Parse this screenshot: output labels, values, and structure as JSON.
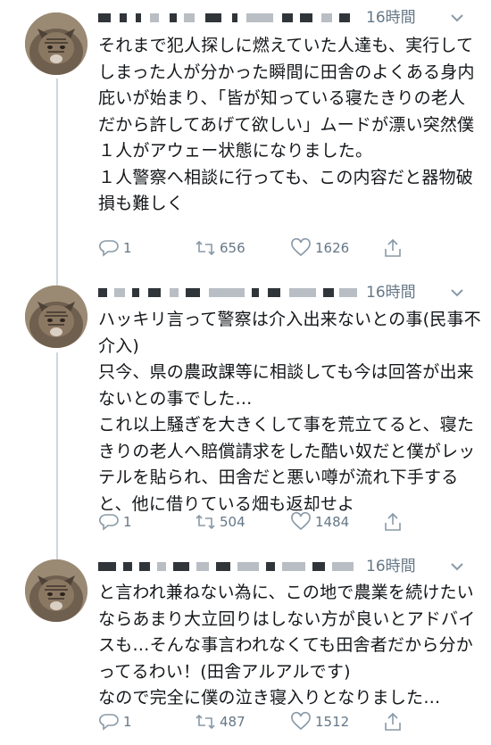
{
  "tweets": [
    {
      "time": "16時間",
      "text": "それまで犯人探しに燃えていた人達も、実行してしまった人が分かった瞬間に田舎のよくある身内庇いが始まり、「皆が知っている寝たきりの老人だから許してあげて欲しい」ムードが漂い突然僕１人がアウェー状態になりました。\n１人警察へ相談に行っても、この内容だと器物破損も難しく",
      "replies": "1",
      "retweets": "656",
      "likes": "1626"
    },
    {
      "time": "16時間",
      "text": "ハッキリ言って警察は介入出来ないとの事(民事不介入)\n只今、県の農政課等に相談しても今は回答が出来ないとの事でした…\nこれ以上騒ぎを大きくして事を荒立てると、寝たきりの老人へ賠償請求をした酷い奴だと僕がレッテルを貼られ、田舎だと悪い噂が流れ下手すると、他に借りている畑も返却せよ",
      "replies": "1",
      "retweets": "504",
      "likes": "1484"
    },
    {
      "time": "16時間",
      "text": "と言われ兼ねない為に、この地で農業を続けたいならあまり大立回りはしない方が良いとアドバイスも…そんな事言われなくても田舎者だから分かってるわい！(田舎アルアルです)\nなので完全に僕の泣き寝入りとなりました…",
      "replies": "1",
      "retweets": "487",
      "likes": "1512"
    }
  ],
  "icons": {
    "reply": "reply-icon",
    "retweet": "retweet-icon",
    "like": "heart-icon",
    "share": "share-icon",
    "more": "more-icon"
  },
  "colors": {
    "text": "#14171a",
    "muted": "#657786",
    "thread_line": "#ccd6dd"
  }
}
